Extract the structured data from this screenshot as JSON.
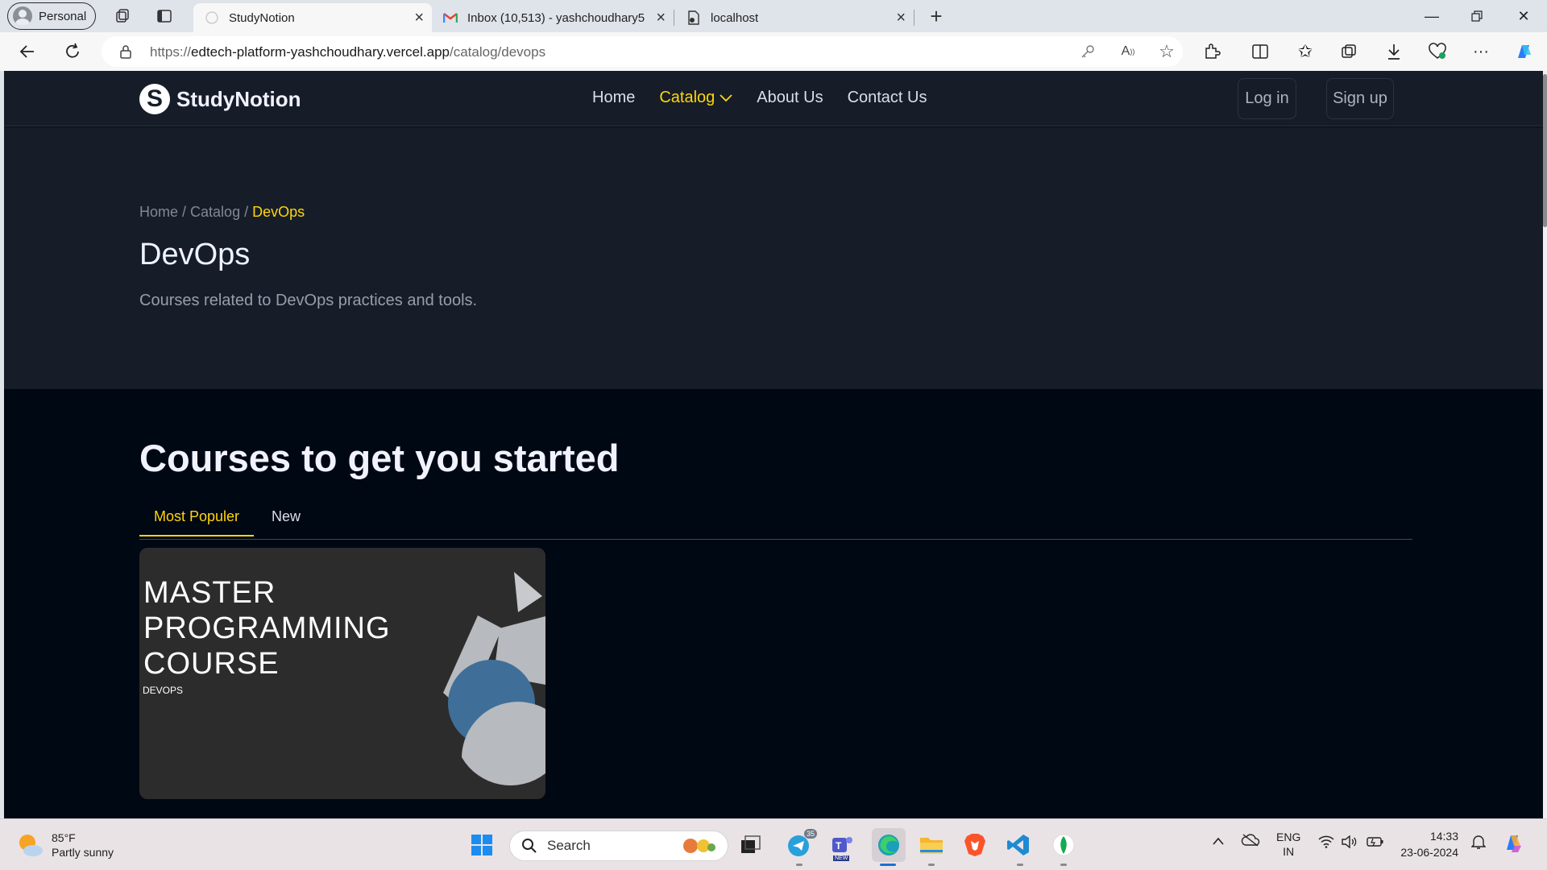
{
  "browser": {
    "profile_label": "Personal",
    "tabs": [
      {
        "title": "StudyNotion",
        "active": true
      },
      {
        "title": "Inbox (10,513) - yashchoudhary5",
        "active": false
      },
      {
        "title": "localhost",
        "active": false
      }
    ],
    "url_prefix": "https://",
    "url_host": "edtech-platform-yashchoudhary.vercel.app",
    "url_path": "/catalog/devops"
  },
  "site": {
    "brand": "StudyNotion",
    "logo_letter": "S",
    "nav": {
      "home": "Home",
      "catalog": "Catalog",
      "about": "About Us",
      "contact": "Contact Us"
    },
    "login": "Log in",
    "signup": "Sign up",
    "accent": "#FFD60A"
  },
  "hero": {
    "crumb_home": "Home",
    "crumb_sep1": " / ",
    "crumb_catalog": "Catalog",
    "crumb_sep2": " / ",
    "crumb_current": "DevOps",
    "title": "DevOps",
    "description": "Courses related to DevOps practices and tools."
  },
  "courses": {
    "heading": "Courses to get you started",
    "tabs": [
      "Most Populer",
      "New"
    ],
    "active_tab": "Most Populer",
    "card": {
      "line1": "MASTER",
      "line2": "PROGRAMMING",
      "line3": "COURSE",
      "tag": "DEVOPS"
    }
  },
  "taskbar": {
    "temperature": "85°F",
    "weather": "Partly sunny",
    "search_placeholder": "Search",
    "telegram_badge": "35",
    "teams_badge": "NEW",
    "lang": "ENG",
    "region": "IN",
    "time": "14:33",
    "date": "23-06-2024"
  }
}
